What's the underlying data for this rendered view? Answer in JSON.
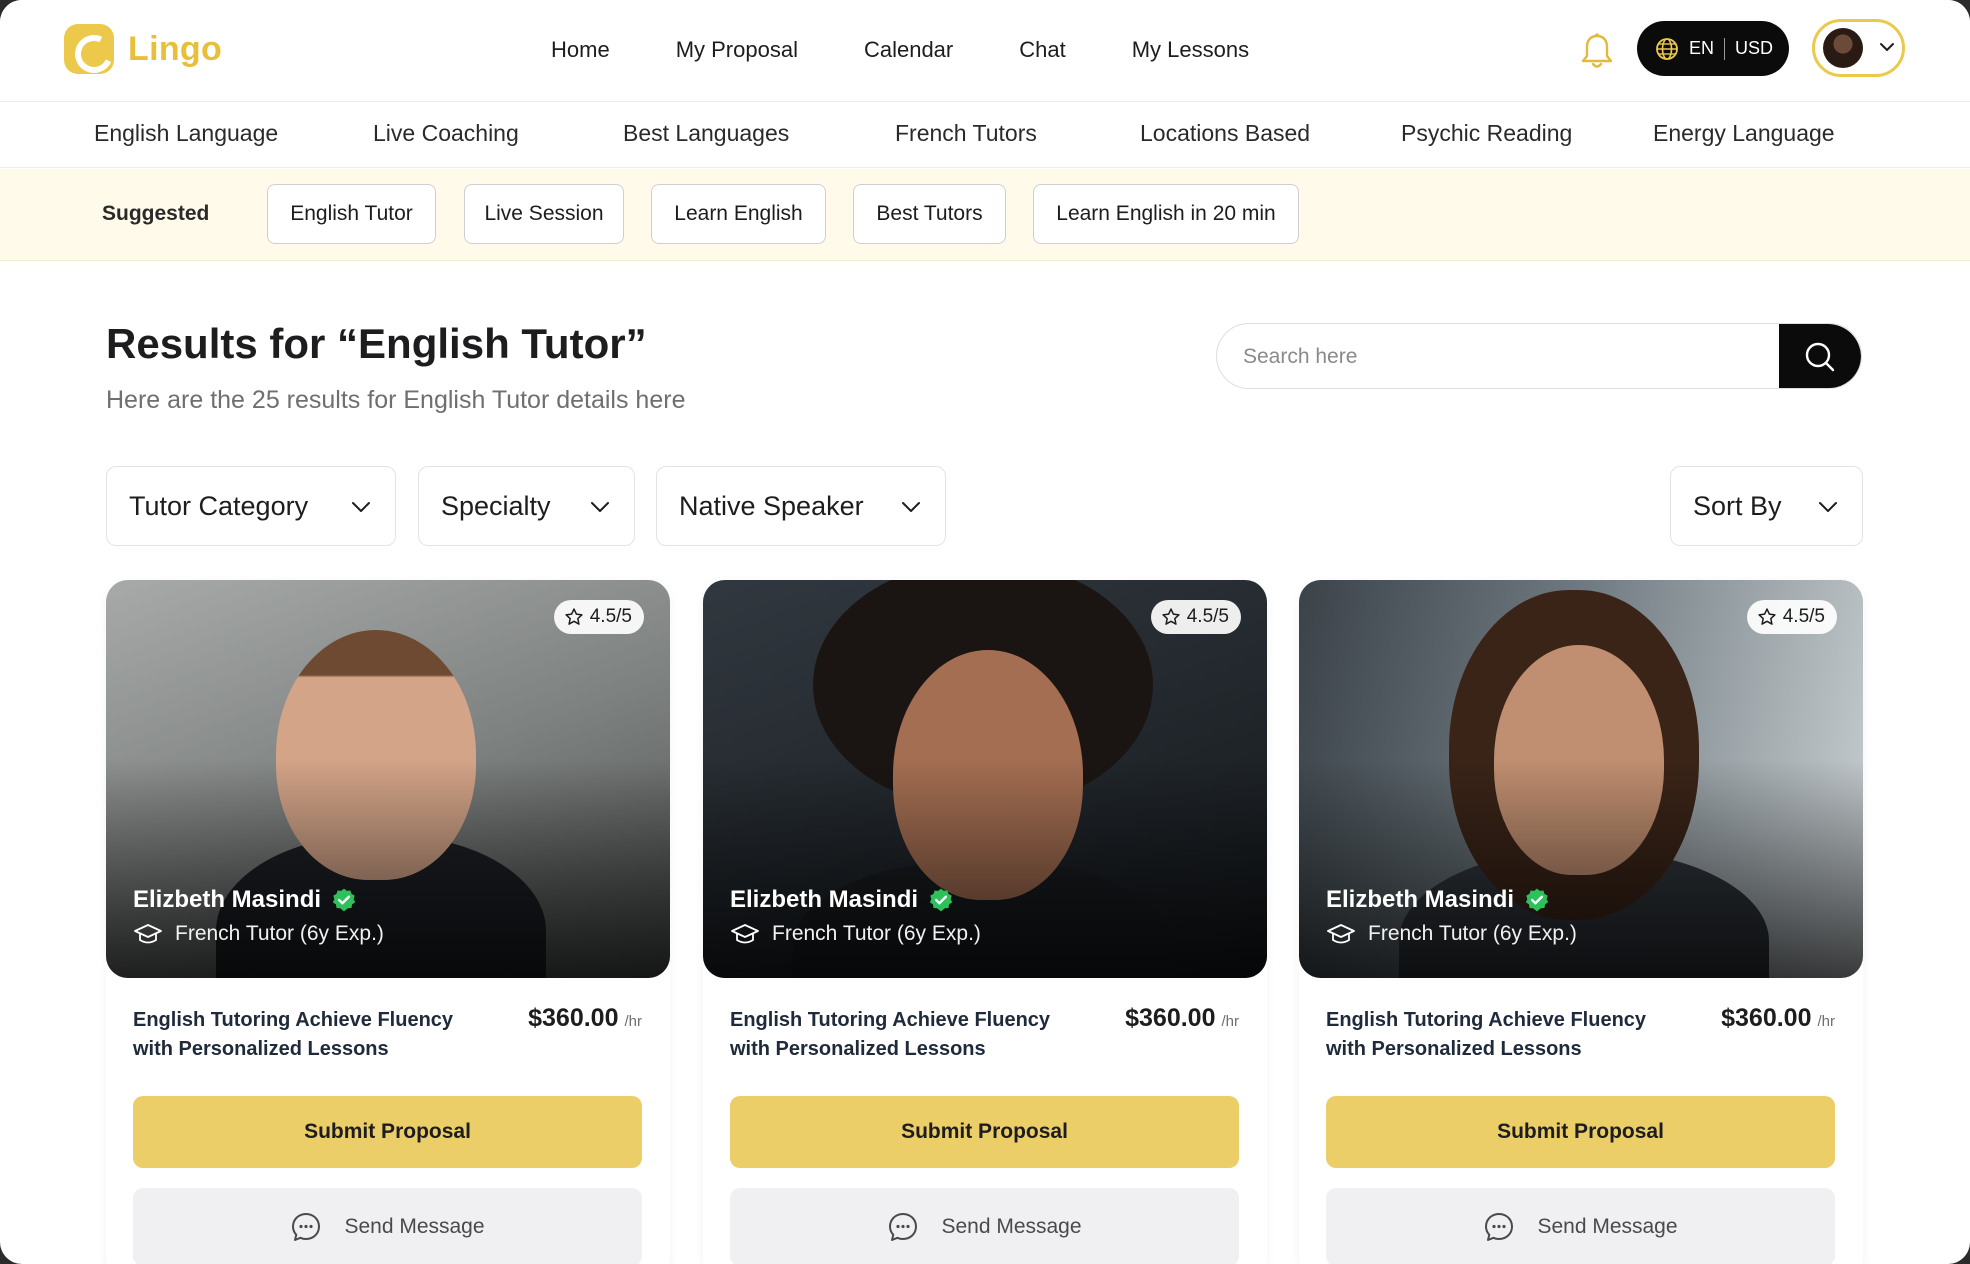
{
  "brand": {
    "name": "Lingo",
    "accent": "#ECCE68"
  },
  "nav": {
    "items": [
      "Home",
      "My Proposal",
      "Calendar",
      "Chat",
      "My Lessons"
    ]
  },
  "header": {
    "language": "EN",
    "currency": "USD",
    "bell_icon": "bell-icon",
    "globe_icon": "globe-icon"
  },
  "categories": [
    "English Language",
    "Live Coaching",
    "Best Languages",
    "French Tutors",
    "Locations Based",
    "Psychic Reading",
    "Energy Language"
  ],
  "suggested": {
    "label": "Suggested",
    "chips": [
      "English Tutor",
      "Live Session",
      "Learn English",
      "Best Tutors",
      "Learn English in 20 min"
    ]
  },
  "results": {
    "prefix": "Results for ",
    "query": "“English Tutor”",
    "subtitle": "Here are the 25 results for English Tutor details here"
  },
  "search": {
    "placeholder": "Search here",
    "value": ""
  },
  "filters": {
    "items": [
      "Tutor Category",
      "Specialty",
      "Native Speaker"
    ],
    "sort": "Sort By"
  },
  "cards": [
    {
      "rating": "4.5/5",
      "name": "Elizbeth Masindi",
      "role": "French Tutor (6y Exp.)",
      "desc": "English Tutoring Achieve Fluency with Personalized Lessons",
      "price": "$360.00",
      "per": "/hr",
      "submit": "Submit Proposal",
      "message": "Send Message"
    },
    {
      "rating": "4.5/5",
      "name": "Elizbeth Masindi",
      "role": "French Tutor (6y Exp.)",
      "desc": "English Tutoring Achieve Fluency with Personalized Lessons",
      "price": "$360.00",
      "per": "/hr",
      "submit": "Submit Proposal",
      "message": "Send Message"
    },
    {
      "rating": "4.5/5",
      "name": "Elizbeth Masindi",
      "role": "French Tutor (6y Exp.)",
      "desc": "English Tutoring Achieve Fluency with Personalized Lessons",
      "price": "$360.00",
      "per": "/hr",
      "submit": "Submit Proposal",
      "message": "Send Message"
    }
  ]
}
